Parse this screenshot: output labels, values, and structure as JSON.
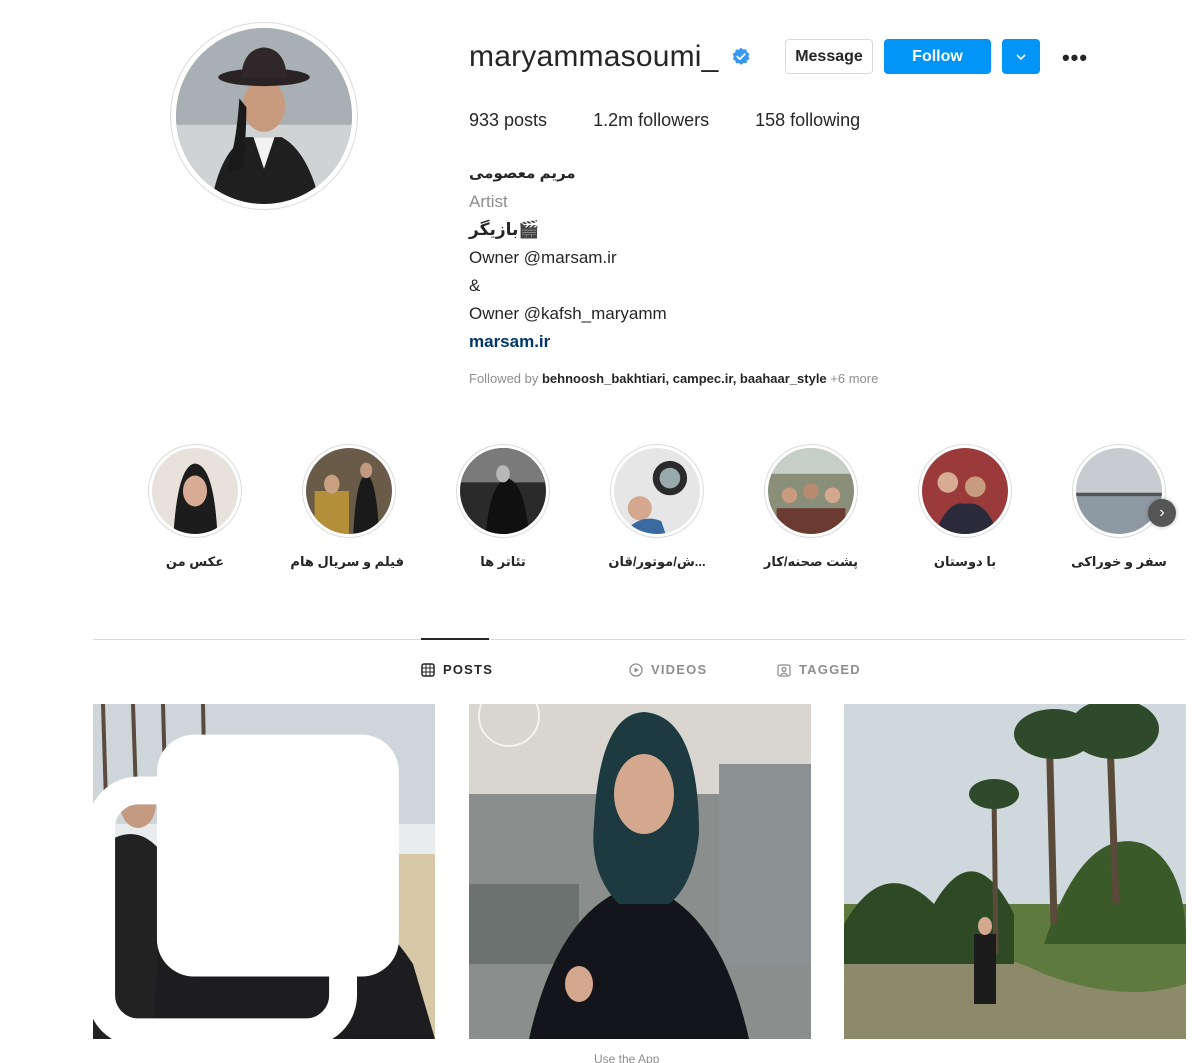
{
  "profile": {
    "username": "maryammasoumi_",
    "verified": true,
    "message_label": "Message",
    "follow_label": "Follow",
    "more_label": "•••",
    "stats": {
      "posts": "933 posts",
      "followers": "1.2m followers",
      "following": "158 following"
    },
    "bio": {
      "full_name": "مریم معصومی",
      "category": "Artist",
      "line1": "🎬بازیگر",
      "line2": "Owner @marsam.ir",
      "line3": "&",
      "line4": "Owner @kafsh_maryamm",
      "website": "marsam.ir"
    },
    "followed_by_prefix": "Followed by ",
    "followed_by_names": "behnoosh_bakhtiari, campec.ir, baahaar_style",
    "followed_by_more": " +6 more"
  },
  "highlights": [
    {
      "label": "عکس من"
    },
    {
      "label": "فیلم و سریال هام"
    },
    {
      "label": "تئاتر ها"
    },
    {
      "label": "...ش/موتور/قان"
    },
    {
      "label": "پشت صحنه/کار"
    },
    {
      "label": "با دوستان"
    },
    {
      "label": "سفر و خوراکی"
    }
  ],
  "tabs": {
    "posts": "POSTS",
    "videos": "VIDEOS",
    "tagged": "TAGGED"
  },
  "footer": {
    "use_app": "Use the App"
  },
  "colors": {
    "accent": "#0095f6",
    "link": "#00376b",
    "muted": "#8e8e8e",
    "border": "#dbdbdb"
  }
}
